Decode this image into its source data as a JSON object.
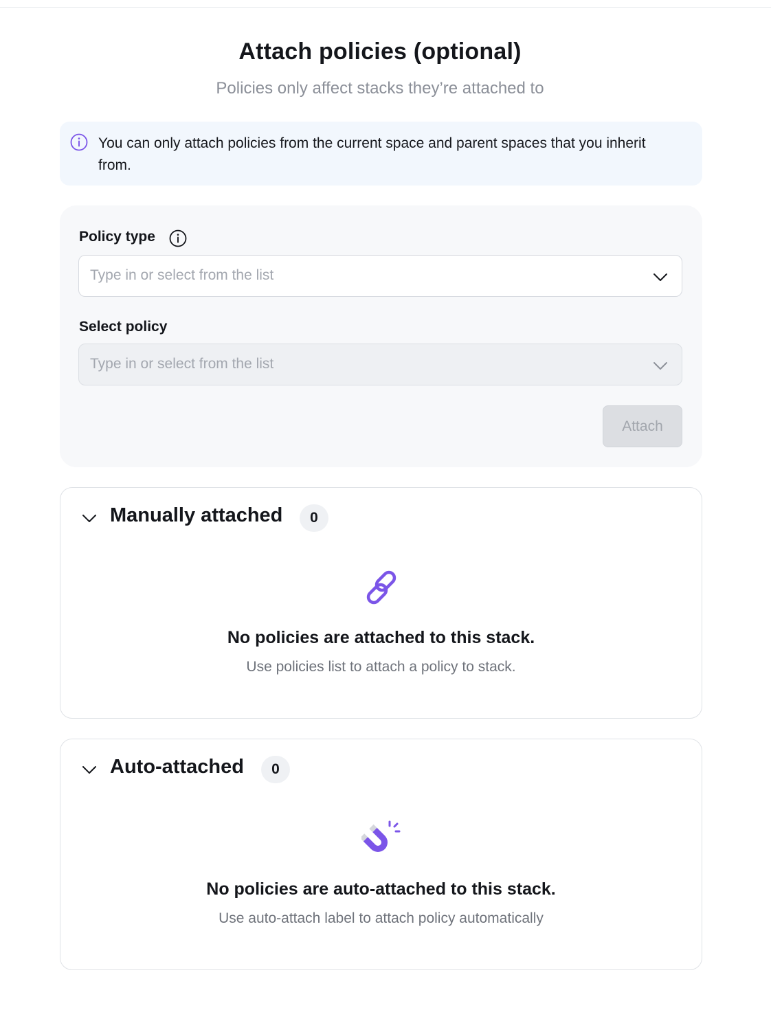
{
  "page": {
    "title": "Attach policies (optional)",
    "subtitle": "Policies only affect stacks they’re attached to"
  },
  "callout": {
    "icon": "info-icon",
    "text": "You can only attach policies from the current space and parent spaces that you inherit from."
  },
  "form": {
    "policy_type": {
      "label": "Policy type",
      "label_icon": "info-icon",
      "placeholder": "Type in or select from the list",
      "value": ""
    },
    "select_policy": {
      "label": "Select policy",
      "placeholder": "Type in or select from the list",
      "value": "",
      "disabled": true
    },
    "attach_button": {
      "label": "Attach",
      "disabled": true
    }
  },
  "sections": {
    "manual": {
      "title": "Manually attached",
      "count": "0",
      "empty_icon": "link-icon",
      "empty_title": "No policies are attached to this stack.",
      "empty_desc": "Use policies list to attach a policy to stack."
    },
    "auto": {
      "title": "Auto-attached",
      "count": "0",
      "empty_icon": "magnet-icon",
      "empty_title": "No policies are auto-attached to this stack.",
      "empty_desc": "Use auto-attach label to attach policy automatically"
    }
  },
  "colors": {
    "accent": "#7b55e8",
    "callout_bg": "#f2f7fd",
    "card_bg": "#f7f8fa",
    "muted_text": "#8b8f98",
    "disabled_button": "#dcdee2"
  }
}
